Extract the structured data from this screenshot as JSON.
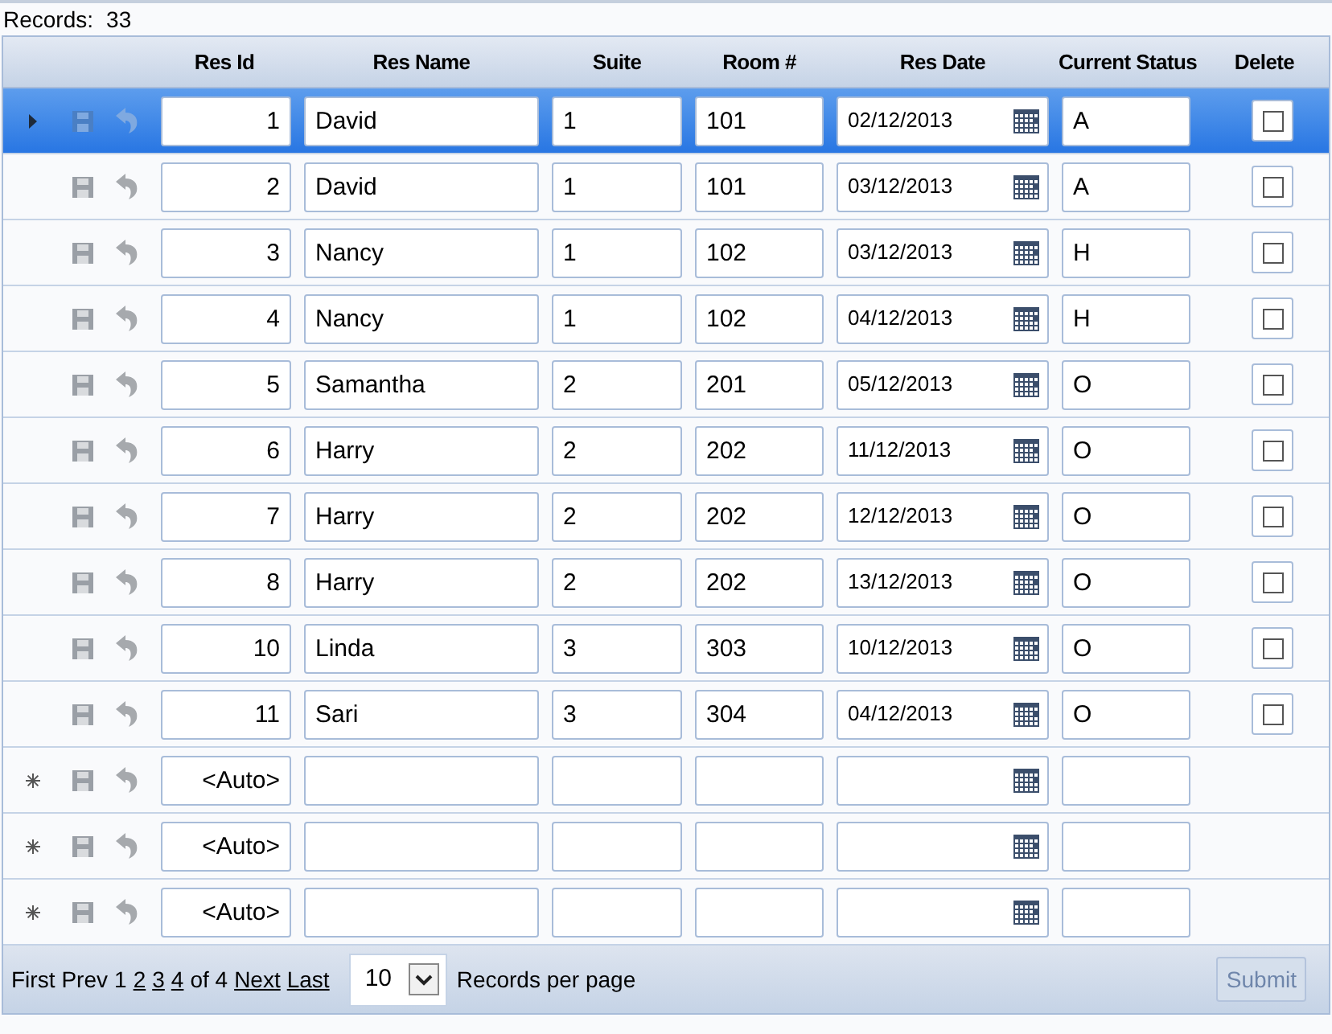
{
  "records_label": "Records:",
  "records_count": "33",
  "columns": [
    "Res Id",
    "Res Name",
    "Suite",
    "Room #",
    "Res Date",
    "Current Status",
    "Delete"
  ],
  "rows": [
    {
      "kind": "record",
      "selected": true,
      "res_id": "1",
      "name": "David",
      "suite": "1",
      "room": "101",
      "date": "02/12/2013",
      "status": "A",
      "delete": false
    },
    {
      "kind": "record",
      "selected": false,
      "res_id": "2",
      "name": "David",
      "suite": "1",
      "room": "101",
      "date": "03/12/2013",
      "status": "A",
      "delete": false
    },
    {
      "kind": "record",
      "selected": false,
      "res_id": "3",
      "name": "Nancy",
      "suite": "1",
      "room": "102",
      "date": "03/12/2013",
      "status": "H",
      "delete": false
    },
    {
      "kind": "record",
      "selected": false,
      "res_id": "4",
      "name": "Nancy",
      "suite": "1",
      "room": "102",
      "date": "04/12/2013",
      "status": "H",
      "delete": false
    },
    {
      "kind": "record",
      "selected": false,
      "res_id": "5",
      "name": "Samantha",
      "suite": "2",
      "room": "201",
      "date": "05/12/2013",
      "status": "O",
      "delete": false
    },
    {
      "kind": "record",
      "selected": false,
      "res_id": "6",
      "name": "Harry",
      "suite": "2",
      "room": "202",
      "date": "11/12/2013",
      "status": "O",
      "delete": false
    },
    {
      "kind": "record",
      "selected": false,
      "res_id": "7",
      "name": "Harry",
      "suite": "2",
      "room": "202",
      "date": "12/12/2013",
      "status": "O",
      "delete": false
    },
    {
      "kind": "record",
      "selected": false,
      "res_id": "8",
      "name": "Harry",
      "suite": "2",
      "room": "202",
      "date": "13/12/2013",
      "status": "O",
      "delete": false
    },
    {
      "kind": "record",
      "selected": false,
      "res_id": "10",
      "name": "Linda",
      "suite": "3",
      "room": "303",
      "date": "10/12/2013",
      "status": "O",
      "delete": false
    },
    {
      "kind": "record",
      "selected": false,
      "res_id": "11",
      "name": "Sari",
      "suite": "3",
      "room": "304",
      "date": "04/12/2013",
      "status": "O",
      "delete": false
    },
    {
      "kind": "new",
      "selected": false,
      "res_id": "<Auto>"
    },
    {
      "kind": "new",
      "selected": false,
      "res_id": "<Auto>"
    },
    {
      "kind": "new",
      "selected": false,
      "res_id": "<Auto>"
    }
  ],
  "pager": {
    "first": {
      "label": "First",
      "disabled": true
    },
    "prev": {
      "label": "Prev",
      "disabled": true
    },
    "pages": [
      {
        "label": "1",
        "selected": true
      },
      {
        "label": "2",
        "selected": false
      },
      {
        "label": "3",
        "selected": false
      },
      {
        "label": "4",
        "selected": false
      }
    ],
    "of_label": "of 4",
    "next": {
      "label": "Next",
      "disabled": false
    },
    "last": {
      "label": "Last",
      "disabled": false
    },
    "page_size": "10",
    "page_size_label": "Records per page"
  },
  "submit": {
    "label": "Submit",
    "disabled": true
  }
}
